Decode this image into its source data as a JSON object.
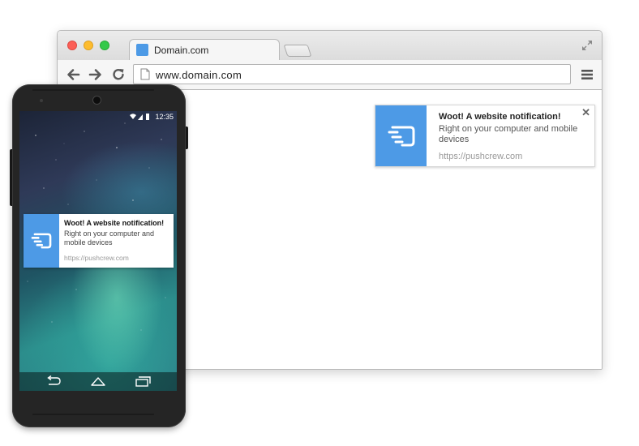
{
  "browser": {
    "tab_title": "Domain.com",
    "url": "www.domain.com"
  },
  "notification": {
    "title": "Woot! A website notification!",
    "body": "Right on your computer and mobile devices",
    "url": "https://pushcrew.com",
    "close_symbol": "✕",
    "icon": "pushcrew-logo-icon",
    "icon_bg": "#4d9ae6"
  },
  "phone": {
    "time": "12:35",
    "notification": {
      "title": "Woot! A website notification!",
      "body": "Right on your computer and mobile devices",
      "url": "https://pushcrew.com"
    }
  },
  "colors": {
    "accent": "#4d9ae6"
  }
}
